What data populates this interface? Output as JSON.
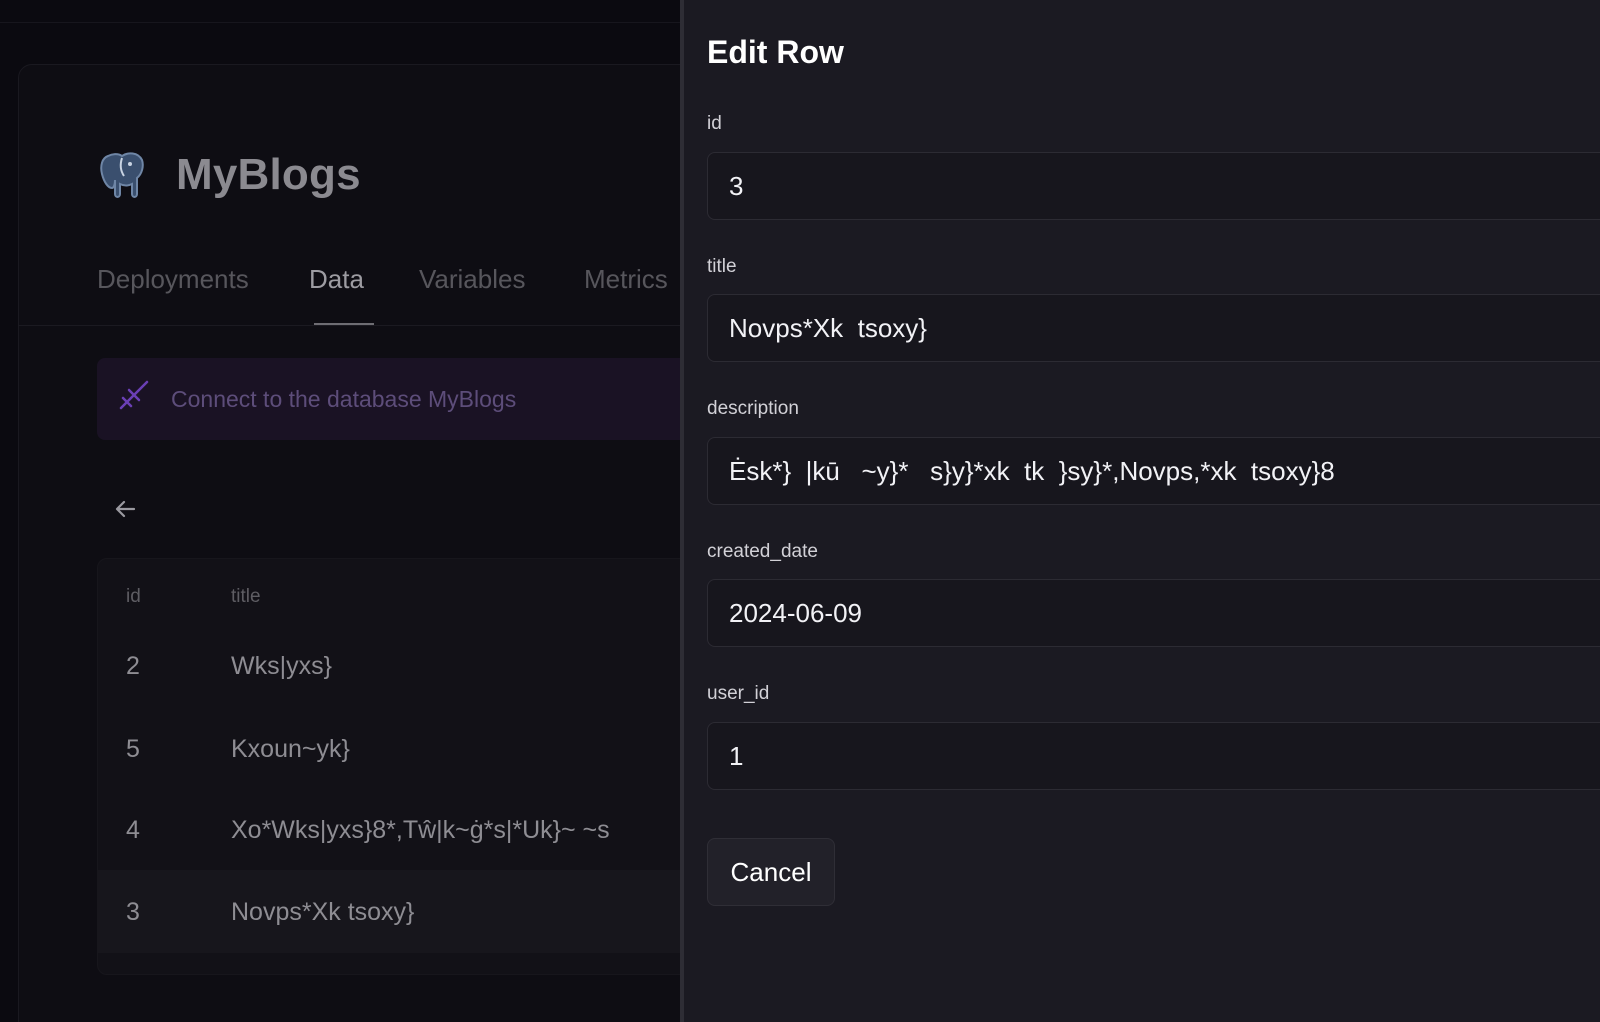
{
  "project": {
    "name": "MyBlogs",
    "logo_icon": "postgres-elephant-icon"
  },
  "tabs": [
    {
      "label": "Deployments",
      "active": false
    },
    {
      "label": "Data",
      "active": true
    },
    {
      "label": "Variables",
      "active": false
    },
    {
      "label": "Metrics",
      "active": false
    }
  ],
  "connect_banner": {
    "icon": "plug-icon",
    "text": "Connect to the database MyBlogs"
  },
  "table": {
    "columns": [
      "id",
      "title"
    ],
    "rows": [
      {
        "id": "2",
        "title": "Wks|yxs}"
      },
      {
        "id": "5",
        "title": "Kxoun~yk}"
      },
      {
        "id": "4",
        "title": "Xo*Wks|yxs}8*,Tŵ|k~ġ*s|*Uk}~   ~s"
      },
      {
        "id": "3",
        "title": "Novps*Xk  tsoxy}"
      }
    ]
  },
  "edit_panel": {
    "title": "Edit Row",
    "fields": {
      "id": {
        "label": "id",
        "value": "3"
      },
      "title": {
        "label": "title",
        "value": "Novps*Xk  tsoxy}"
      },
      "description": {
        "label": "description",
        "value": "Ėsk*}  |kū   ~y}*   s}y}*xk  tk  }sy}*,Novps,*xk  tsoxy}8"
      },
      "created_date": {
        "label": "created_date",
        "value": "2024-06-09"
      },
      "user_id": {
        "label": "user_id",
        "value": "1"
      }
    },
    "cancel_label": "Cancel"
  },
  "colors": {
    "panel_bg": "#1b1a22",
    "page_bg": "#0b0a10",
    "accent_purple": "#6a3fb5"
  }
}
